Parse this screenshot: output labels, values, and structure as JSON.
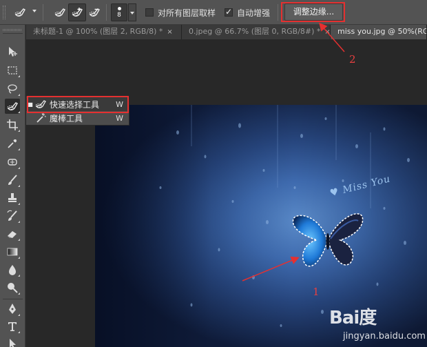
{
  "options_bar": {
    "brush_size": "8",
    "sample_all_layers_label": "对所有图层取样",
    "sample_all_layers_checked": false,
    "auto_enhance_label": "自动增强",
    "auto_enhance_checked": true,
    "refine_edge_label": "调整边缘..."
  },
  "tabs": [
    {
      "label": "未标题-1 @ 100% (图层 2, RGB/8) *",
      "close": "×",
      "active": false
    },
    {
      "label": "0.jpeg @ 66.7% (图层 0, RGB/8#) *",
      "close": "×",
      "active": false
    },
    {
      "label": "miss you.jpg @ 50%(RG",
      "close": "",
      "active": true
    }
  ],
  "tools": [
    "move-tool-icon",
    "marquee-tool-icon",
    "lasso-tool-icon",
    "quick-selection-tool-icon",
    "crop-tool-icon",
    "eyedropper-tool-icon",
    "healing-brush-tool-icon",
    "brush-tool-icon",
    "clone-stamp-tool-icon",
    "history-brush-tool-icon",
    "eraser-tool-icon",
    "gradient-tool-icon",
    "blur-tool-icon",
    "dodge-tool-icon",
    "pen-tool-icon",
    "type-tool-icon",
    "path-selection-tool-icon"
  ],
  "flyout": {
    "items": [
      {
        "label": "快速选择工具",
        "key": "W",
        "selected": true
      },
      {
        "label": "魔棒工具",
        "key": "W",
        "selected": false
      }
    ]
  },
  "canvas": {
    "overlay_text": "♥ Miss You"
  },
  "annotations": {
    "number_1": "1",
    "number_2": "2",
    "color": "#e53030"
  },
  "watermark": {
    "logo": "Bai度",
    "url": "jingyan.baidu.com"
  }
}
